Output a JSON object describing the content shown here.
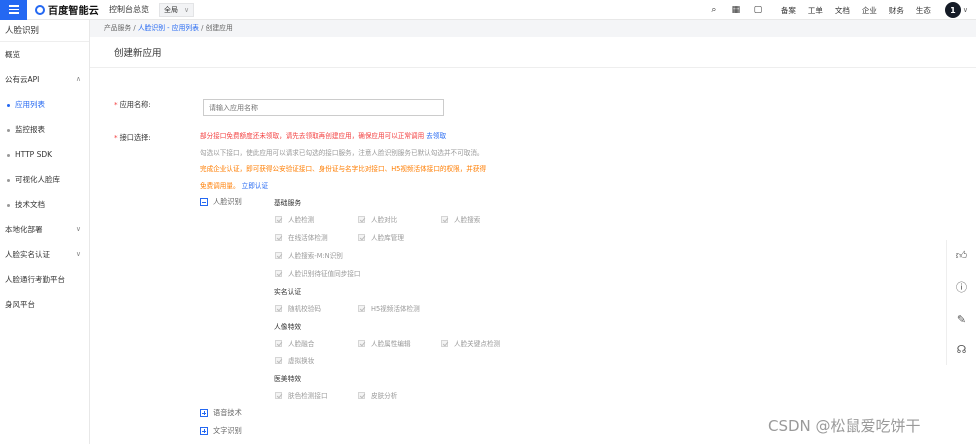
{
  "topbar": {
    "logo_text": "百度智能云",
    "console_link": "控制台总览",
    "region": "全局",
    "icons": [
      "search-icon",
      "grid-icon",
      "message-icon"
    ],
    "items": [
      "备案",
      "工单",
      "文档",
      "企业",
      "财务",
      "生态"
    ],
    "avatar": "1"
  },
  "sidebar": {
    "title": "人脸识别",
    "items": {
      "overview": "概览",
      "public_api": "公有云API",
      "app_list": "应用列表",
      "monitor": "监控报表",
      "http_sdk": "HTTP SDK",
      "visual_lib": "可视化人脸库",
      "tech_docs": "技术文档",
      "local_deploy": "本地化部署",
      "real_name": "人脸实名认证",
      "access": "人脸通行考勤平台",
      "risk": "身风平台"
    }
  },
  "breadcrumb": {
    "product": "产品服务",
    "sep1": " / ",
    "app_list": "人脸识别 - 应用列表",
    "sep2": " / ",
    "current": "创建应用"
  },
  "panel": {
    "title": "创建新应用",
    "app_name_label": "应用名称:",
    "app_name_placeholder": "请输入应用名称",
    "api_label": "接口选择:",
    "note1": "部分接口免费额度还未领取，请先去领取再创建应用，确保应用可以正常调用",
    "note1_link": "去领取",
    "note2": "勾选以下接口，使此应用可以请求已勾选的接口服务，注意人脸识别服务已默认勾选并不可取消。",
    "note3": "完成企业认证，即可获得公安验证接口、身份证与名字比对接口、H5视频活体接口的权限，并获得",
    "note4": "免费调用量。",
    "note4_link": "立即认证",
    "tree": {
      "face": "人脸识别",
      "speech": "语音技术",
      "ocr": "文字识别"
    },
    "groups": {
      "basic": "基础服务",
      "real_name": "实名认证",
      "image": "人像特效",
      "beauty": "医美特效"
    },
    "checks": {
      "detect": "人脸检测",
      "compare": "人脸对比",
      "search": "人脸搜索",
      "liveness": "在线活体检测",
      "lib_manage": "人脸库管理",
      "search_mn": "人脸搜索-M:N识别",
      "sync": "人脸识别待征值同步接口",
      "code": "随机校验码",
      "h5": "H5视频活体检测",
      "merge": "人脸融合",
      "attr_edit": "人脸属性编辑",
      "keypoint": "人脸关键点检测",
      "virtual": "虚拟换妆",
      "skin_color": "肤色检测接口",
      "skin": "皮肤分析"
    }
  },
  "float_icons": [
    "thumbs-up-icon",
    "help-icon",
    "edit-icon",
    "headset-icon"
  ],
  "watermark": "CSDN @松鼠爱吃饼干"
}
